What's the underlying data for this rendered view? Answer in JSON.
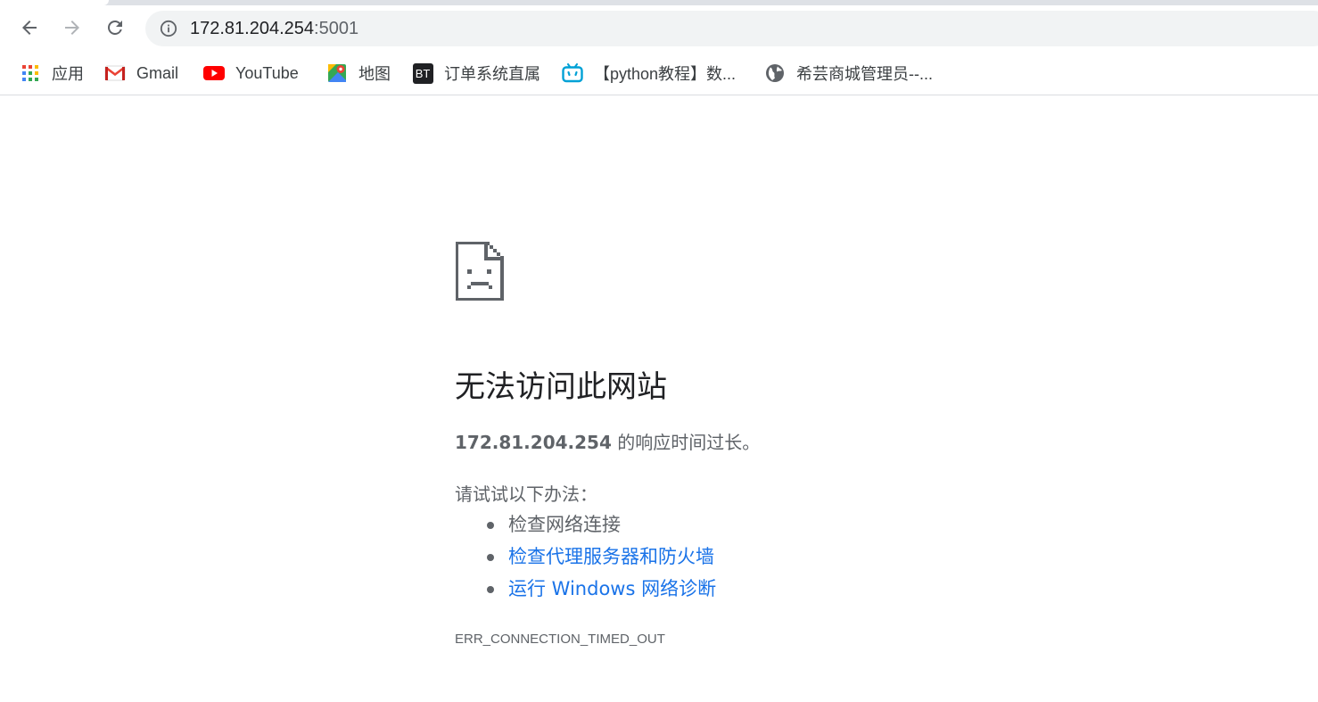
{
  "toolbar": {
    "back_icon": "arrow-left-icon",
    "forward_icon": "arrow-right-icon",
    "reload_icon": "reload-icon",
    "address": {
      "info_icon": "info-circle-icon",
      "host": "172.81.204.254",
      "port": ":5001"
    }
  },
  "bookmarks": [
    {
      "label": "应用",
      "icon": "apps-grid-icon"
    },
    {
      "label": "Gmail",
      "icon": "gmail-icon"
    },
    {
      "label": "YouTube",
      "icon": "youtube-icon"
    },
    {
      "label": "地图",
      "icon": "maps-icon"
    },
    {
      "label": "订单系统直属",
      "icon": "bt-icon",
      "icon_text": "BT"
    },
    {
      "label": "【python教程】数...",
      "icon": "bilibili-icon"
    },
    {
      "label": "希芸商城管理员--...",
      "icon": "globe-icon"
    }
  ],
  "error_page": {
    "icon": "sad-document-icon",
    "title": "无法访问此网站",
    "host": "172.81.204.254",
    "description_suffix": " 的响应时间过长。",
    "try_label": "请试试以下办法：",
    "suggestions": [
      {
        "text": "检查网络连接",
        "link": false
      },
      {
        "text": "检查代理服务器和防火墙",
        "link": true
      },
      {
        "text": "运行 Windows 网络诊断",
        "link": true
      }
    ],
    "error_code": "ERR_CONNECTION_TIMED_OUT"
  },
  "colors": {
    "link": "#1a73e8",
    "text_secondary": "#5f6368",
    "omnibox_bg": "#f1f3f4",
    "youtube_red": "#ff0000"
  }
}
